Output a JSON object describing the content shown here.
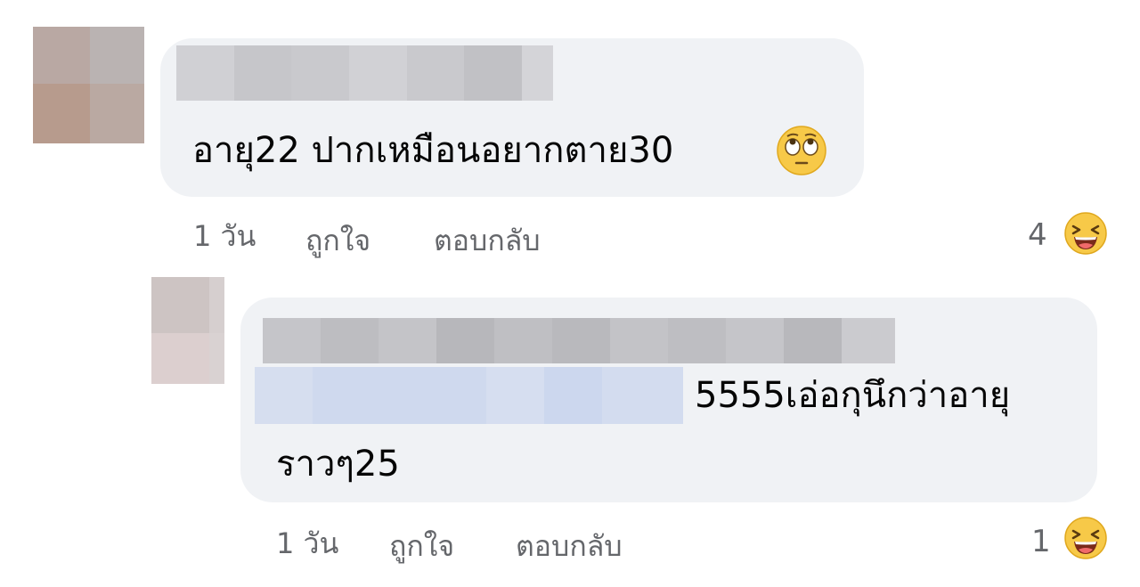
{
  "comments": [
    {
      "text": "อายุ22 ปากเหมือนอยากตาย30",
      "emoji": "face-with-rolling-eyes",
      "time": "1 วัน",
      "like_label": "ถูกใจ",
      "reply_label": "ตอบกลับ",
      "reaction_count": "4",
      "reaction_icon": "laughing-face"
    },
    {
      "text_line1": "5555เอ่อกุนึกว่าอายุ",
      "text_line2": "ราวๆ25",
      "time": "1 วัน",
      "like_label": "ถูกใจ",
      "reply_label": "ตอบกลับ",
      "reaction_count": "1",
      "reaction_icon": "laughing-face"
    }
  ],
  "colors": {
    "bubble": "#f0f2f5",
    "meta_text": "#65676b",
    "body_text": "#050505",
    "blur_gray": "#c6c7cb",
    "blur_blue": "#d3dcef"
  }
}
